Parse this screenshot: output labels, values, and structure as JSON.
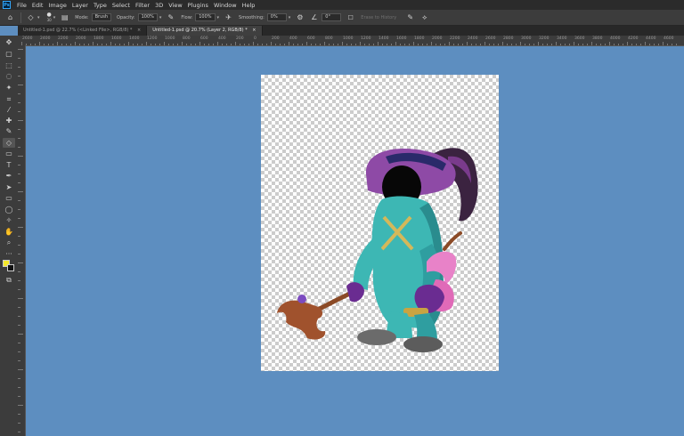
{
  "menubar": {
    "app_icon": "Ps",
    "items": [
      "File",
      "Edit",
      "Image",
      "Layer",
      "Type",
      "Select",
      "Filter",
      "3D",
      "View",
      "Plugins",
      "Window",
      "Help"
    ]
  },
  "options": {
    "brush_size": "30",
    "mode_label": "Mode:",
    "mode_value": "Brush",
    "opacity_label": "Opacity:",
    "opacity_value": "100%",
    "flow_label": "Flow:",
    "flow_value": "100%",
    "smoothing_label": "Smoothing:",
    "smoothing_value": "0%",
    "angle_value": "0°",
    "erase_history_label": "Erase to History"
  },
  "tabs": [
    {
      "label": "Untitled-1.psd @ 22.7% (<Linked File>, RGB/8) *",
      "active": false
    },
    {
      "label": "Untitled-1.psd @ 20.7% (Layer 2, RGB/8) *",
      "active": true
    }
  ],
  "ruler": {
    "labels": [
      "2600",
      "2400",
      "2200",
      "2000",
      "1800",
      "1600",
      "1400",
      "1200",
      "1000",
      "800",
      "600",
      "400",
      "200",
      "0",
      "200",
      "400",
      "600",
      "800",
      "1000",
      "1200",
      "1400",
      "1600",
      "1800",
      "2000",
      "2200",
      "2400",
      "2600",
      "2800",
      "3000",
      "3200",
      "3400",
      "3600",
      "3800",
      "4000",
      "4200",
      "4400",
      "4600"
    ]
  },
  "tools": [
    "move-tool",
    "artboard-tool",
    "marquee-tool",
    "lasso-tool",
    "magic-wand-tool",
    "crop-tool",
    "eyedropper-tool",
    "healing-brush-tool",
    "brush-tool",
    "eraser-tool",
    "gradient-tool",
    "type-tool",
    "pen-tool",
    "path-selection-tool",
    "rectangle-tool",
    "ellipse-tool",
    "custom-shape-tool",
    "hand-tool",
    "zoom-tool",
    "edit-toolbar",
    "foreground-color",
    "background-color",
    "screen-mode"
  ],
  "colors": {
    "workspace": "#5d8ec0",
    "foreground": "#f5e92a",
    "background": "#111111"
  }
}
